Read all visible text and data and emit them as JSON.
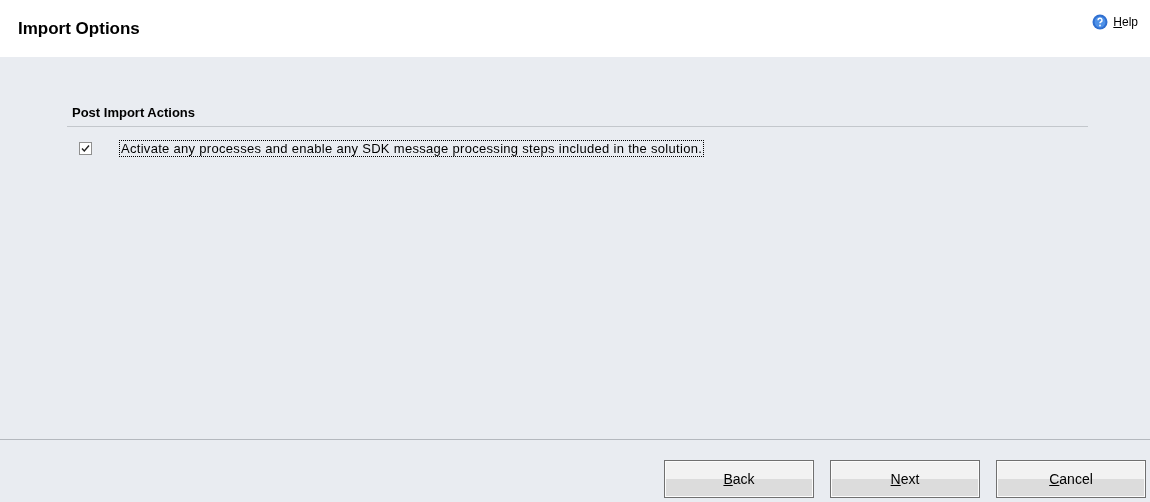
{
  "header": {
    "title": "Import Options",
    "help": {
      "key": "H",
      "rest": "elp"
    }
  },
  "section": {
    "title": "Post Import Actions",
    "option": {
      "label": "Activate any processes and enable any SDK message processing steps included in the solution.",
      "checked": true,
      "focused": true
    }
  },
  "buttons": [
    {
      "key": "B",
      "rest": "ack"
    },
    {
      "key": "N",
      "rest": "ext"
    },
    {
      "key": "C",
      "rest": "ancel"
    }
  ]
}
